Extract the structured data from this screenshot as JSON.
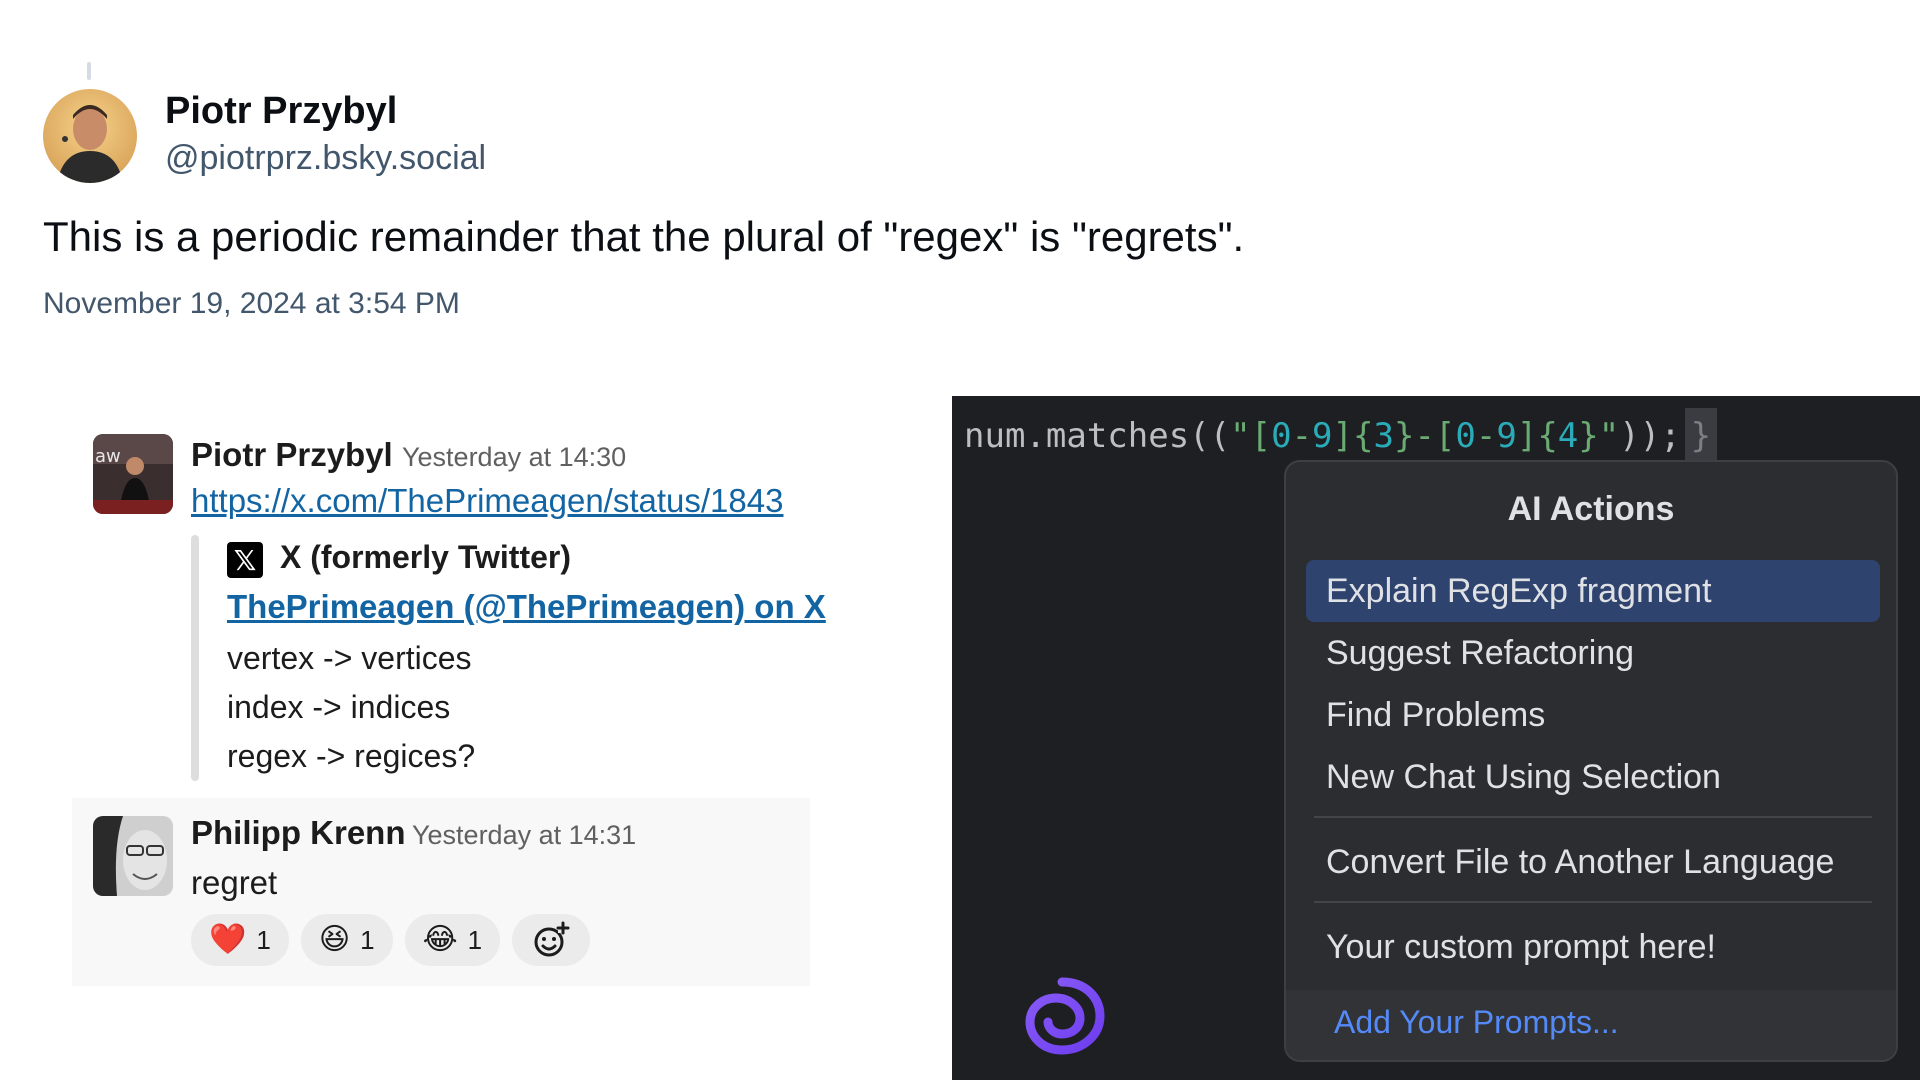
{
  "bluesky": {
    "author_name": "Piotr Przybyl",
    "handle": "@piotrprz.bsky.social",
    "text": "This is a periodic remainder that the plural of \"regex\" is \"regrets\".",
    "date": "November 19, 2024 at 3:54 PM"
  },
  "slack": {
    "message1": {
      "author": "Piotr Przybyl",
      "time": "Yesterday at 14:30",
      "link": "https://x.com/ThePrimeagen/status/1843",
      "unfurl": {
        "icon": "x-logo-icon",
        "source": "X (formerly Twitter)",
        "title": "ThePrimeagen (@ThePrimeagen) on X",
        "lines": [
          "vertex -> vertices",
          "index -> indices",
          "regex -> regices?"
        ]
      }
    },
    "message2": {
      "author": "Philipp Krenn",
      "time": "Yesterday at 14:31",
      "text": "regret",
      "reactions": [
        {
          "emoji": "❤️",
          "icon": "heart-emoji",
          "count": "1"
        },
        {
          "emoji": "😆",
          "icon": "laughing-emoji",
          "count": "1"
        },
        {
          "emoji": "😂",
          "icon": "tears-of-joy-emoji",
          "count": "1"
        }
      ],
      "add_reaction_icon": "add-reaction-icon"
    }
  },
  "ide": {
    "code": {
      "prefix": "num.matches((",
      "q_open": "\"",
      "s1": "[",
      "n1": "0",
      "s2": "-",
      "n2": "9",
      "s3": "]{",
      "n3": "3",
      "s4": "}-[",
      "n4": "0",
      "s5": "-",
      "n5": "9",
      "s6": "]{",
      "n6": "4",
      "s7": "}",
      "q_close": "\"",
      "suffix": "));",
      "brace": "}"
    },
    "popup": {
      "title": "AI Actions",
      "items": [
        "Explain RegExp fragment",
        "Suggest Refactoring",
        "Find Problems",
        "New Chat Using Selection",
        "Convert File to Another Language",
        "Your custom prompt here!"
      ],
      "selected_index": 0,
      "footer": "Add Your Prompts..."
    },
    "logo_icon": "ai-assistant-swirl-icon"
  },
  "colors": {
    "link": "#1264a3",
    "selected_item": "#2e436e",
    "footer_link": "#548af7",
    "code_string": "#6aab73",
    "code_number": "#2aacb8"
  }
}
